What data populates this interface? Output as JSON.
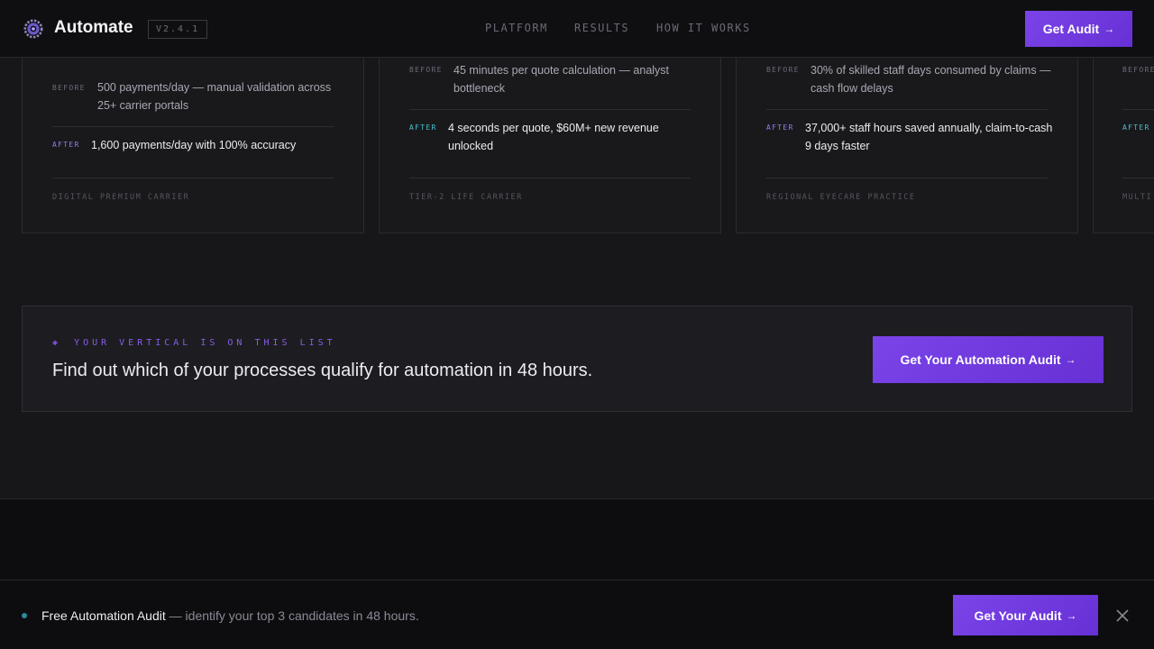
{
  "header": {
    "brand": "Automate",
    "version": "V2.4.1",
    "nav": [
      "PLATFORM",
      "RESULTS",
      "HOW IT WORKS"
    ],
    "cta_label": "Get Audit",
    "cta_arrow": "→"
  },
  "cards": [
    {
      "before_label": "BEFORE",
      "before_text": "500 payments/day — manual validation across 25+ carrier portals",
      "after_label": "AFTER",
      "after_text": "1,600 payments/day with 100% accuracy",
      "tag": "DIGITAL PREMIUM CARRIER"
    },
    {
      "before_label": "BEFORE",
      "before_text": "45 minutes per quote calculation — analyst bottleneck",
      "after_label": "AFTER",
      "after_text": "4 seconds per quote, $60M+ new revenue unlocked",
      "tag": "TIER-2 LIFE CARRIER"
    },
    {
      "before_label": "BEFORE",
      "before_text": "30% of skilled staff days consumed by claims — cash flow delays",
      "after_label": "AFTER",
      "after_text": "37,000+ staff hours saved annually, claim-to-cash 9 days faster",
      "tag": "REGIONAL EYECARE PRACTICE"
    },
    {
      "before_label": "BEFORE",
      "after_label": "AFTER",
      "tag": "MULTI-"
    }
  ],
  "cta": {
    "eyebrow_icon": "◈",
    "eyebrow": "YOUR VERTICAL IS ON THIS LIST",
    "title": "Find out which of your processes qualify for automation in 48 hours.",
    "button_label": "Get Your Automation Audit",
    "button_arrow": "→"
  },
  "bottom_bar": {
    "strong": "Free Automation Audit",
    "rest": " — identify your top 3 candidates in 48 hours.",
    "button_label": "Get Your Audit",
    "button_arrow": "→"
  },
  "colors": {
    "accent": "#7a44e8",
    "teal": "#4ac0cc",
    "background": "#17171a"
  }
}
